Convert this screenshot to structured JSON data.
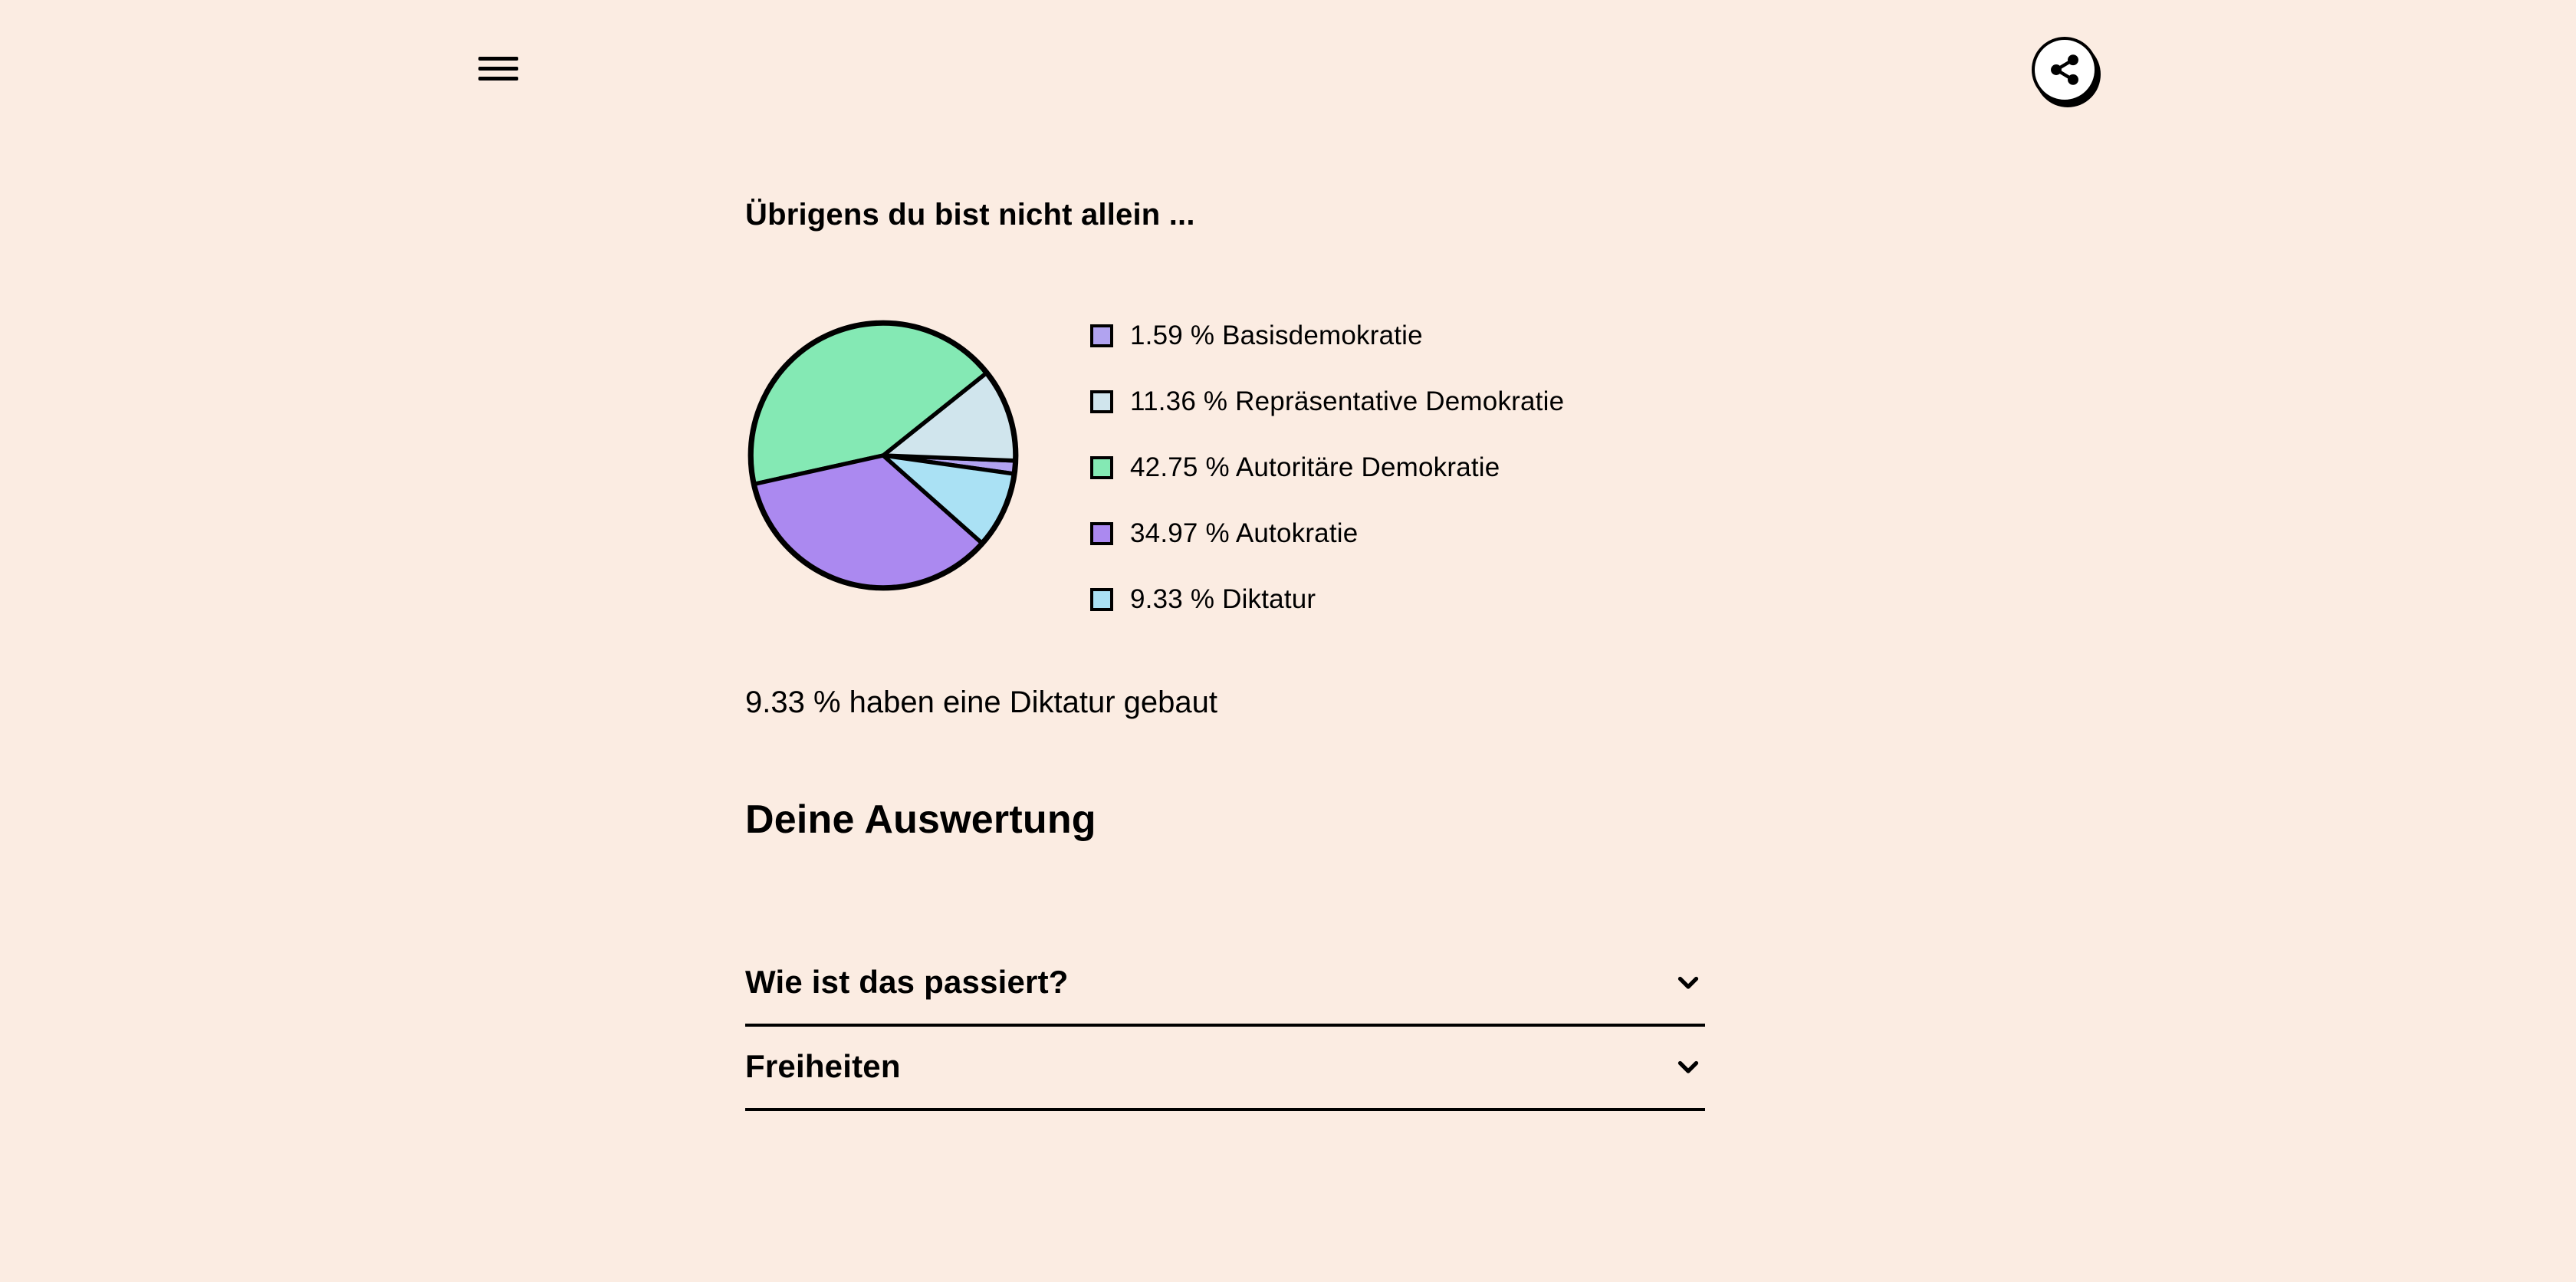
{
  "lead_text": "Übrigens du bist nicht allein ...",
  "chart_data": {
    "type": "pie",
    "title": "",
    "series": [
      {
        "name": "Basisdemokratie",
        "value": 1.59,
        "color": "#b1a3f0"
      },
      {
        "name": "Repräsentative Demokratie",
        "value": 11.36,
        "color": "#d0e5ed"
      },
      {
        "name": "Autoritäre Demokratie",
        "value": 42.75,
        "color": "#84e9b4"
      },
      {
        "name": "Autokratie",
        "value": 34.97,
        "color": "#ab89f0"
      },
      {
        "name": "Diktatur",
        "value": 9.33,
        "color": "#aae1f4"
      }
    ]
  },
  "legend": [
    {
      "label": "1.59 % Basisdemokratie",
      "color": "#b1a3f0"
    },
    {
      "label": "11.36 % Repräsentative Demokratie",
      "color": "#d0e5ed"
    },
    {
      "label": "42.75 % Autoritäre Demokratie",
      "color": "#84e9b4"
    },
    {
      "label": "34.97 % Autokratie",
      "color": "#ab89f0"
    },
    {
      "label": "9.33 % Diktatur",
      "color": "#aae1f4"
    }
  ],
  "summary_line": "9.33 % haben eine Diktatur gebaut",
  "evaluation_heading": "Deine Auswertung",
  "accordion": [
    {
      "title": "Wie ist das passiert?"
    },
    {
      "title": "Freiheiten"
    }
  ]
}
